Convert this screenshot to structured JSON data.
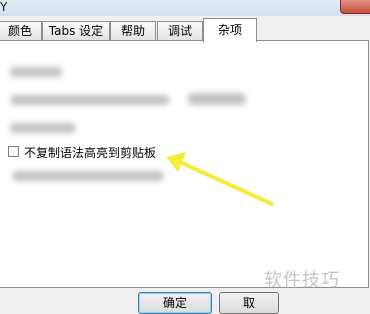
{
  "window": {
    "title_fragment": "Y"
  },
  "tabs": [
    {
      "label": "颜色",
      "active": false
    },
    {
      "label": "Tabs 设定",
      "active": false
    },
    {
      "label": "帮助",
      "active": false
    },
    {
      "label": "调试",
      "active": false
    },
    {
      "label": "杂项",
      "active": true
    }
  ],
  "misc": {
    "no_copy_syntax_highlight": {
      "label": "不复制语法高亮到剪贴板",
      "checked": false
    }
  },
  "buttons": {
    "ok_label": "确定",
    "cancel_label": "取"
  },
  "watermark": "软件技巧",
  "colors": {
    "arrow": "#f4ec3a",
    "default_button_border": "#3c7fb1"
  }
}
